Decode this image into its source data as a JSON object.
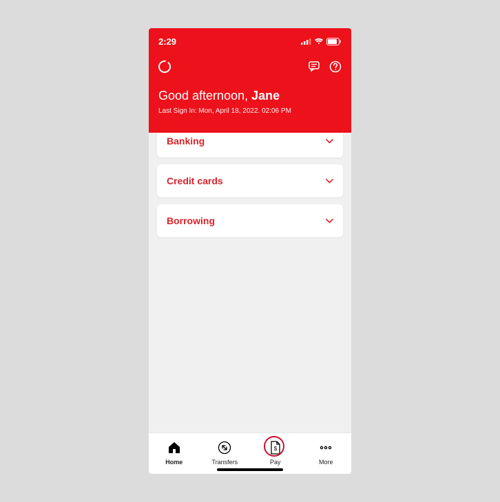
{
  "status_bar": {
    "time": "2:29"
  },
  "header": {
    "greeting_prefix": "Good afternoon, ",
    "user_name": "Jane",
    "last_sign_in": "Last Sign In: Mon, April 18, 2022. 02:06 PM"
  },
  "sections": {
    "banking": "Banking",
    "credit_cards": "Credit cards",
    "borrowing": "Borrowing"
  },
  "tabs": {
    "home": "Home",
    "transfers": "Transfers",
    "pay": "Pay",
    "more": "More"
  }
}
